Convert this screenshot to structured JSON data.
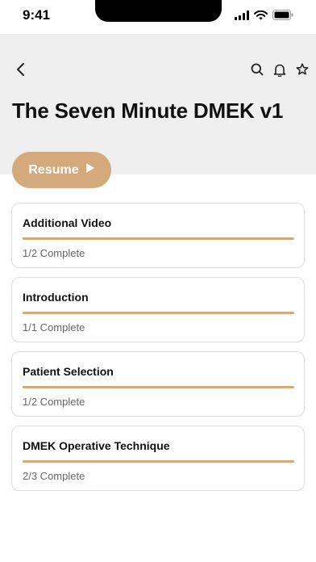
{
  "status_bar": {
    "time": "9:41"
  },
  "header": {
    "title": "The Seven Minute DMEK v1"
  },
  "resume": {
    "label": "Resume"
  },
  "sections": [
    {
      "title": "Additional Video",
      "status": "1/2 Complete",
      "progress": 1.0
    },
    {
      "title": "Introduction",
      "status": "1/1 Complete",
      "progress": 1.0
    },
    {
      "title": "Patient Selection",
      "status": "1/2 Complete",
      "progress": 1.0
    },
    {
      "title": "DMEK Operative Technique",
      "status": "2/3 Complete",
      "progress": 1.0
    }
  ],
  "colors": {
    "accent": "#d4a97b",
    "header_bg": "#efefef"
  },
  "icons": [
    "back-icon",
    "search-icon",
    "bell-icon",
    "star-icon",
    "play-icon",
    "signal-icon",
    "wifi-icon",
    "battery-icon"
  ]
}
